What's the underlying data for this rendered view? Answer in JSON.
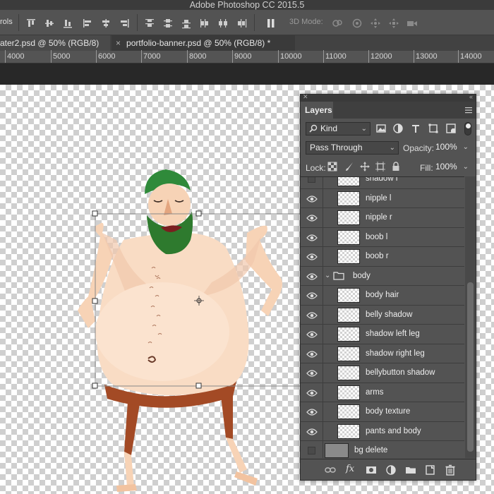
{
  "app": {
    "title": "Adobe Photoshop CC 2015.5"
  },
  "options_bar": {
    "controls_label": "rols",
    "mode_label": "3D Mode:"
  },
  "tabs": [
    {
      "label": "ater2.psd @ 50% (RGB/8)",
      "close": "×"
    },
    {
      "label": "portfolio-banner.psd @ 50% (RGB/8) *",
      "close": "×"
    }
  ],
  "ruler": {
    "ticks": [
      "4000",
      "5000",
      "6000",
      "7000",
      "8000",
      "9000",
      "10000",
      "11000",
      "12000",
      "13000",
      "14000"
    ]
  },
  "layers_panel": {
    "tab": "Layers",
    "filter_kind": "Kind",
    "blend_mode": "Pass Through",
    "opacity_label": "Opacity:",
    "opacity": "100%",
    "lock_label": "Lock:",
    "fill_label": "Fill:",
    "fill": "100%",
    "layers": [
      {
        "name": "shadow l",
        "visible": false
      },
      {
        "name": "nipple l",
        "visible": true
      },
      {
        "name": "nipple r",
        "visible": true
      },
      {
        "name": "boob l",
        "visible": true
      },
      {
        "name": "boob r",
        "visible": true
      },
      {
        "name": "body",
        "visible": true,
        "group": true
      },
      {
        "name": "body hair",
        "visible": true
      },
      {
        "name": "belly shadow",
        "visible": true
      },
      {
        "name": "shadow left leg",
        "visible": true
      },
      {
        "name": "shadow right leg",
        "visible": true
      },
      {
        "name": "bellybutton shadow",
        "visible": true
      },
      {
        "name": "arms",
        "visible": true
      },
      {
        "name": "body texture",
        "visible": true
      },
      {
        "name": "pants and body",
        "visible": true
      },
      {
        "name": "bg delete",
        "visible": false,
        "background": true
      }
    ],
    "bottom_icons": [
      "link-icon",
      "fx-icon",
      "mask-icon",
      "adjustment-icon",
      "new-group-icon",
      "new-layer-icon",
      "trash-icon"
    ],
    "fx_label": "fx"
  },
  "colors": {
    "panel_bg": "#535353",
    "beard": "#2e7a2e",
    "hair": "#2f8a3a",
    "skin": "#f7d3b6",
    "pants": "#a34a25"
  }
}
